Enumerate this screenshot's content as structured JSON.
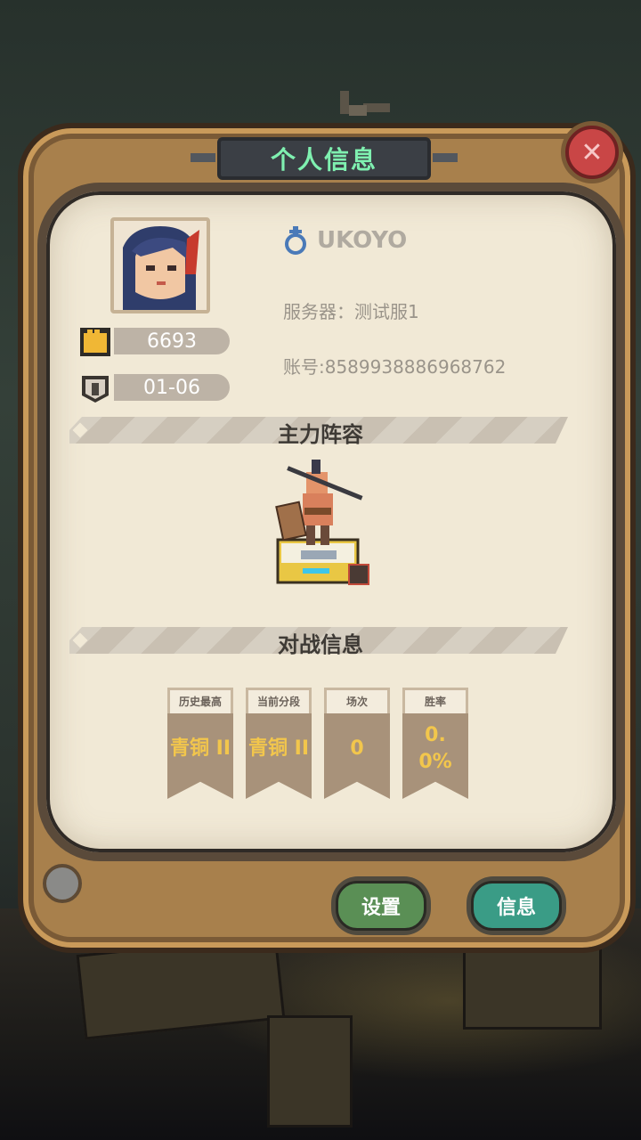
{
  "dialog": {
    "title": "个人信息"
  },
  "player": {
    "name": "UKOYO",
    "power": "6693",
    "stage": "01-06",
    "server": "服务器：测试服1",
    "account": "账号:8589938886968762"
  },
  "sections": {
    "lineup": "主力阵容",
    "battle": "对战信息"
  },
  "battle_stats": [
    {
      "label": "历史最高",
      "value": "青铜 II"
    },
    {
      "label": "当前分段",
      "value": "青铜 II"
    },
    {
      "label": "场次",
      "value": "0"
    },
    {
      "label": "胜率",
      "value": "0.0%"
    }
  ],
  "buttons": {
    "settings": "设置",
    "info": "信息"
  },
  "icons": {
    "close": "close-icon",
    "power": "fist-icon",
    "stage": "tower-icon",
    "gender": "female-symbol-icon"
  },
  "colors": {
    "title_text": "#7ff0b0",
    "settings_button": "#5a8f55",
    "info_button": "#3a9c86",
    "close_button": "#c94646"
  }
}
